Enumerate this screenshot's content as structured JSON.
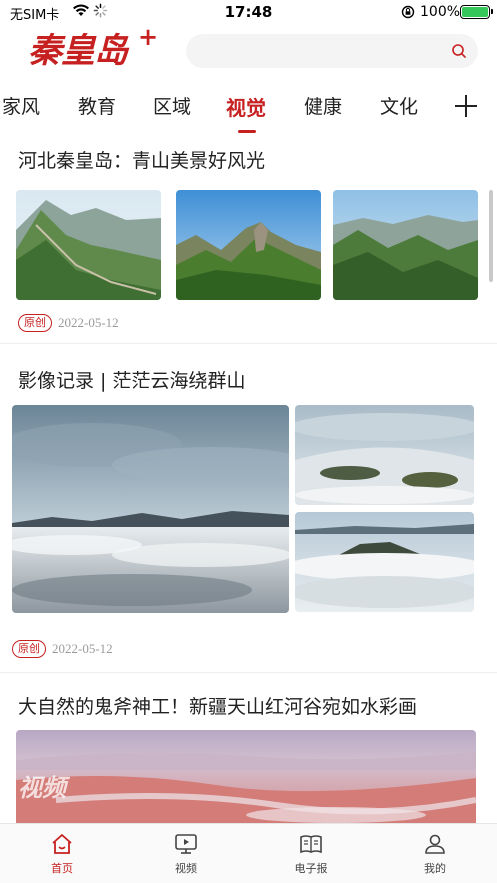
{
  "status_bar": {
    "carrier": "无SIM卡",
    "time": "17:48",
    "battery_percent": "100%"
  },
  "header": {
    "logo_text": "秦皇岛",
    "logo_plus": "+",
    "search": {
      "placeholder": ""
    }
  },
  "channels": {
    "items": [
      {
        "label": "家风",
        "active": false
      },
      {
        "label": "教育",
        "active": false
      },
      {
        "label": "区域",
        "active": false
      },
      {
        "label": "视觉",
        "active": true
      },
      {
        "label": "健康",
        "active": false
      },
      {
        "label": "文化",
        "active": false
      }
    ],
    "add_icon": "plus-icon"
  },
  "articles": [
    {
      "title": "河北秦皇岛：青山美景好风光",
      "badge": "原创",
      "date": "2022-05-12",
      "images": [
        "great-wall-ridge-photo",
        "rocky-peak-photo",
        "mountain-valley-photo"
      ]
    },
    {
      "title": "影像记录 | 茫茫云海绕群山",
      "badge": "原创",
      "date": "2022-05-12",
      "images": [
        "cloud-sea-large-photo",
        "cloud-sea-top-photo",
        "cloud-sea-bottom-photo"
      ]
    },
    {
      "title": "大自然的鬼斧神工！新疆天山红河谷宛如水彩画",
      "video_watermark": "视频",
      "images": [
        "red-valley-video-cover"
      ]
    }
  ],
  "tabbar": {
    "items": [
      {
        "label": "首页",
        "icon": "home-icon",
        "active": true
      },
      {
        "label": "视频",
        "icon": "video-icon",
        "active": false
      },
      {
        "label": "电子报",
        "icon": "newspaper-icon",
        "active": false
      },
      {
        "label": "我的",
        "icon": "profile-icon",
        "active": false
      }
    ]
  },
  "colors": {
    "brand_red": "#c62020",
    "battery_green": "#35c759",
    "meta_gray": "#9a9a9a"
  }
}
